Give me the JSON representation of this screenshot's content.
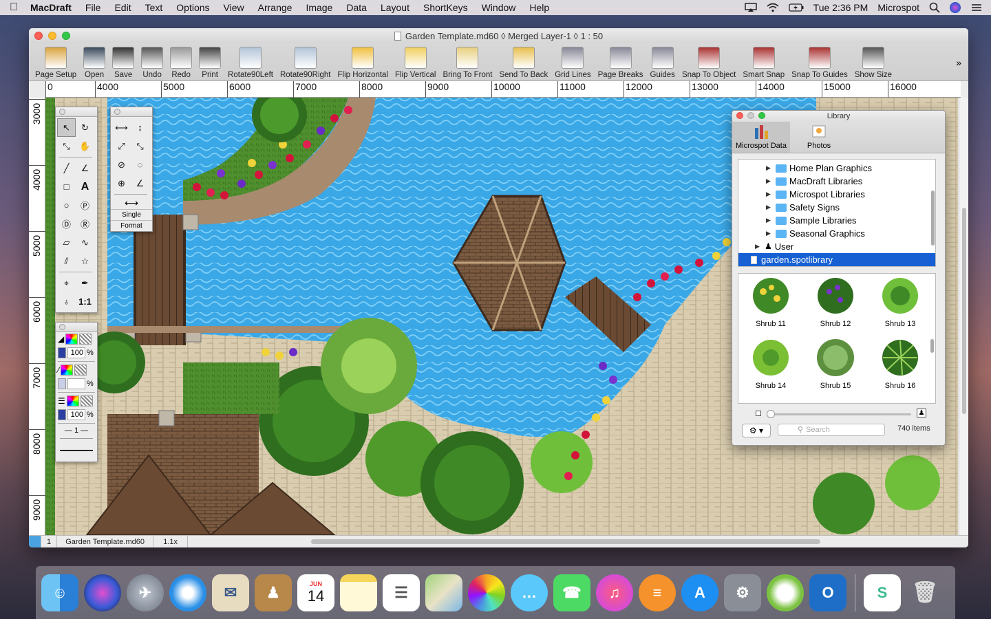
{
  "menubar": {
    "app_name": "MacDraft",
    "items": [
      "File",
      "Edit",
      "Text",
      "Options",
      "View",
      "Arrange",
      "Image",
      "Data",
      "Layout",
      "ShortKeys",
      "Window",
      "Help"
    ],
    "clock": "Tue 2:36 PM",
    "user": "Microspot"
  },
  "window": {
    "title": "Garden Template.md60 ◊ Merged Layer-1 ◊ 1 : 50"
  },
  "toolbar": {
    "buttons": [
      {
        "label": "Page Setup",
        "icon": "page-setup-icon"
      },
      {
        "label": "Open",
        "icon": "open-icon"
      },
      {
        "label": "Save",
        "icon": "save-icon"
      },
      {
        "label": "Undo",
        "icon": "undo-icon"
      },
      {
        "label": "Redo",
        "icon": "redo-icon"
      },
      {
        "label": "Print",
        "icon": "print-icon"
      },
      {
        "label": "Rotate90Left",
        "icon": "rotate-left-icon"
      },
      {
        "label": "Rotate90Right",
        "icon": "rotate-right-icon"
      },
      {
        "label": "Flip Horizontal",
        "icon": "flip-horizontal-icon"
      },
      {
        "label": "Flip Vertical",
        "icon": "flip-vertical-icon"
      },
      {
        "label": "Bring To Front",
        "icon": "bring-front-icon"
      },
      {
        "label": "Send To Back",
        "icon": "send-back-icon"
      },
      {
        "label": "Grid Lines",
        "icon": "grid-lines-icon"
      },
      {
        "label": "Page Breaks",
        "icon": "page-breaks-icon"
      },
      {
        "label": "Guides",
        "icon": "guides-icon"
      },
      {
        "label": "Snap To Object",
        "icon": "snap-object-icon"
      },
      {
        "label": "Smart Snap",
        "icon": "smart-snap-icon"
      },
      {
        "label": "Snap To Guides",
        "icon": "snap-guides-icon"
      },
      {
        "label": "Show Size",
        "icon": "show-size-icon"
      }
    ],
    "more": "»"
  },
  "ruler_top": [
    "0",
    "4000",
    "5000",
    "6000",
    "7000",
    "8000",
    "9000",
    "10000",
    "11000",
    "12000",
    "13000",
    "14000",
    "15000",
    "16000"
  ],
  "ruler_left": [
    "3000",
    "4000",
    "5000",
    "6000",
    "7000",
    "8000",
    "9000"
  ],
  "tool_palette": {
    "line_style_label": "Single",
    "format_label": "Format",
    "scale_label": "1:1",
    "fill_opacity": "100",
    "pen_opacity": "100",
    "percent": "%",
    "line_weight": "1"
  },
  "library": {
    "title": "Library",
    "tabs": [
      {
        "label": "Microspot Data"
      },
      {
        "label": "Photos"
      }
    ],
    "tree": [
      {
        "label": "Home Plan Graphics"
      },
      {
        "label": "MacDraft Libraries"
      },
      {
        "label": "Microspot Libraries"
      },
      {
        "label": "Safety Signs"
      },
      {
        "label": "Sample Libraries"
      },
      {
        "label": "Seasonal Graphics"
      },
      {
        "label": "User"
      },
      {
        "label": "garden.spotlibrary"
      }
    ],
    "shrubs": [
      "Shrub 11",
      "Shrub 12",
      "Shrub 13",
      "Shrub 14",
      "Shrub 15",
      "Shrub 16"
    ],
    "search_placeholder": "Search",
    "item_count": "740 items"
  },
  "statusbar": {
    "page": "1",
    "filename": "Garden Template.md60",
    "zoom": "1.1x"
  },
  "dock": {
    "apps": [
      "finder-icon",
      "siri-icon",
      "launchpad-icon",
      "safari-icon",
      "mail-icon",
      "contacts-icon",
      "calendar-icon",
      "notes-icon",
      "reminders-icon",
      "maps-icon",
      "photos-icon",
      "messages-icon",
      "facetime-icon",
      "itunes-icon",
      "ibooks-icon",
      "app-store-icon",
      "system-preferences-icon",
      "macdraft-icon",
      "outlook-icon",
      "slack-icon",
      "trash-icon"
    ],
    "calendar_month": "JUN",
    "calendar_day": "14"
  }
}
